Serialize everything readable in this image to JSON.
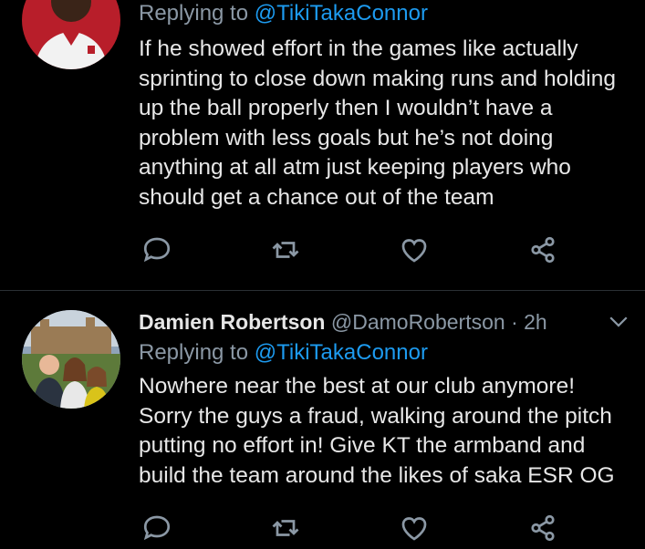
{
  "tweets": [
    {
      "reply_prefix": "Replying to ",
      "reply_to": "@TikiTakaConnor",
      "body": "If he showed effort in the games like actually sprinting to close down making runs and holding up the ball properly then I wouldn’t have a problem with less goals but he’s not doing anything at all atm just keeping players who should get a chance out of the team",
      "actions": [
        "reply-icon",
        "retweet-icon",
        "like-icon",
        "share-icon"
      ]
    },
    {
      "name": "Damien Robertson",
      "handle": "@DamoRobertson",
      "time": " · 2h",
      "reply_prefix": "Replying to ",
      "reply_to": "@TikiTakaConnor",
      "body": "Nowhere near the best at our club anymore! Sorry the guys a fraud, walking around the pitch putting no effort in! Give KT the armband and build the team around the likes of saka ESR OG",
      "actions": [
        "reply-icon",
        "retweet-icon",
        "like-icon",
        "share-icon"
      ]
    }
  ],
  "colors": {
    "background": "#000000",
    "link": "#1d9bf0",
    "muted": "#8b98a5",
    "text": "#e7e7e7",
    "divider": "#2a2f33"
  }
}
